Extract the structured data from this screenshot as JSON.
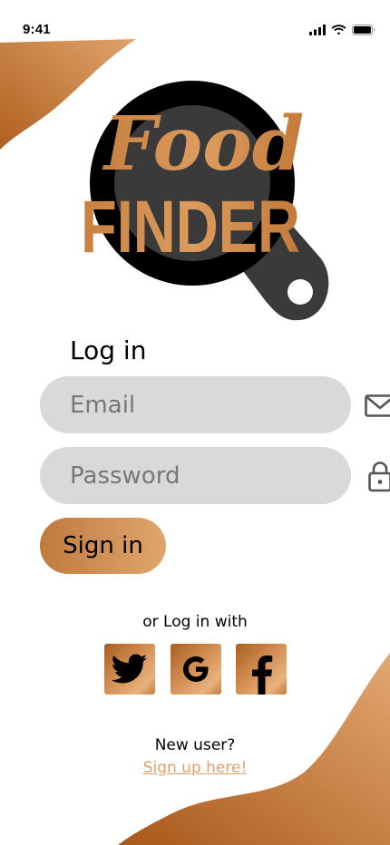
{
  "status_bar": {
    "time": "9:41",
    "icons": [
      "cellular-signal-icon",
      "wifi-icon",
      "battery-icon"
    ]
  },
  "logo": {
    "word_top": "Food",
    "word_bottom": "FINDER",
    "icon": "frying-pan-icon"
  },
  "login": {
    "title": "Log in",
    "email_placeholder": "Email",
    "email_icon": "mail-icon",
    "password_placeholder": "Password",
    "password_icon": "lock-icon",
    "signin_label": "Sign in"
  },
  "social": {
    "caption": "or Log in with",
    "providers": [
      "twitter-icon",
      "google-icon",
      "facebook-icon"
    ]
  },
  "signup": {
    "prompt": "New user?",
    "link_label": "Sign up here!"
  },
  "colors": {
    "accent_dark": "#b0692c",
    "accent_light": "#e0a66d",
    "field_bg": "#d9d9d9",
    "pan": "#000000",
    "pan_handle": "#3a3a3a",
    "link": "#e0a06a"
  }
}
